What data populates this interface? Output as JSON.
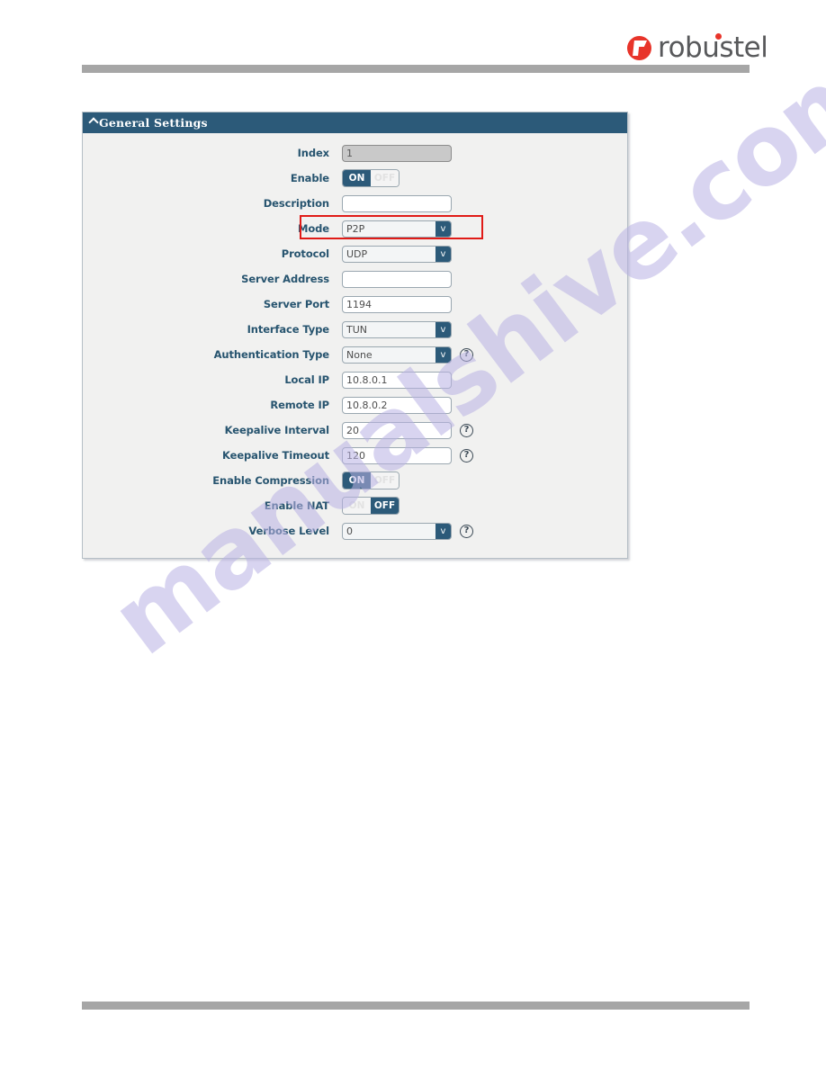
{
  "brand": {
    "name": "robustel",
    "logo_icon": "robustel-logo-icon",
    "accent_color": "#e8342a",
    "text_color": "#58595b"
  },
  "watermark": {
    "text": "manualshive.com",
    "color": "#b9b2e4"
  },
  "panel": {
    "title": "General Settings",
    "collapse_icon": "chevron-up-icon",
    "header_color": "#2c5a79",
    "highlight_color": "#e01b17",
    "rows": [
      {
        "label": "Index",
        "type": "input",
        "value": "1",
        "disabled": true,
        "help": false,
        "highlighted": false
      },
      {
        "label": "Enable",
        "type": "toggle",
        "value": "ON",
        "on_label": "ON",
        "off_label": "OFF",
        "help": false,
        "highlighted": false
      },
      {
        "label": "Description",
        "type": "input",
        "value": "",
        "disabled": false,
        "help": false,
        "highlighted": false
      },
      {
        "label": "Mode",
        "type": "select",
        "value": "P2P",
        "arrow": "v",
        "help": false,
        "highlighted": true
      },
      {
        "label": "Protocol",
        "type": "select",
        "value": "UDP",
        "arrow": "v",
        "help": false,
        "highlighted": false
      },
      {
        "label": "Server Address",
        "type": "input",
        "value": "",
        "disabled": false,
        "help": false,
        "highlighted": false
      },
      {
        "label": "Server Port",
        "type": "input",
        "value": "1194",
        "disabled": false,
        "help": false,
        "highlighted": false
      },
      {
        "label": "Interface Type",
        "type": "select",
        "value": "TUN",
        "arrow": "v",
        "help": false,
        "highlighted": false
      },
      {
        "label": "Authentication Type",
        "type": "select",
        "value": "None",
        "arrow": "v",
        "help": true,
        "highlighted": false
      },
      {
        "label": "Local IP",
        "type": "input",
        "value": "10.8.0.1",
        "disabled": false,
        "help": false,
        "highlighted": false
      },
      {
        "label": "Remote IP",
        "type": "input",
        "value": "10.8.0.2",
        "disabled": false,
        "help": false,
        "highlighted": false
      },
      {
        "label": "Keepalive Interval",
        "type": "input",
        "value": "20",
        "disabled": false,
        "help": true,
        "highlighted": false
      },
      {
        "label": "Keepalive Timeout",
        "type": "input",
        "value": "120",
        "disabled": false,
        "help": true,
        "highlighted": false
      },
      {
        "label": "Enable Compression",
        "type": "toggle",
        "value": "ON",
        "on_label": "ON",
        "off_label": "OFF",
        "help": false,
        "highlighted": false
      },
      {
        "label": "Enable NAT",
        "type": "toggle",
        "value": "OFF",
        "on_label": "ON",
        "off_label": "OFF",
        "help": false,
        "highlighted": false
      },
      {
        "label": "Verbose Level",
        "type": "select",
        "value": "0",
        "arrow": "v",
        "help": true,
        "highlighted": false
      }
    ]
  },
  "help_icon_glyph": "?"
}
